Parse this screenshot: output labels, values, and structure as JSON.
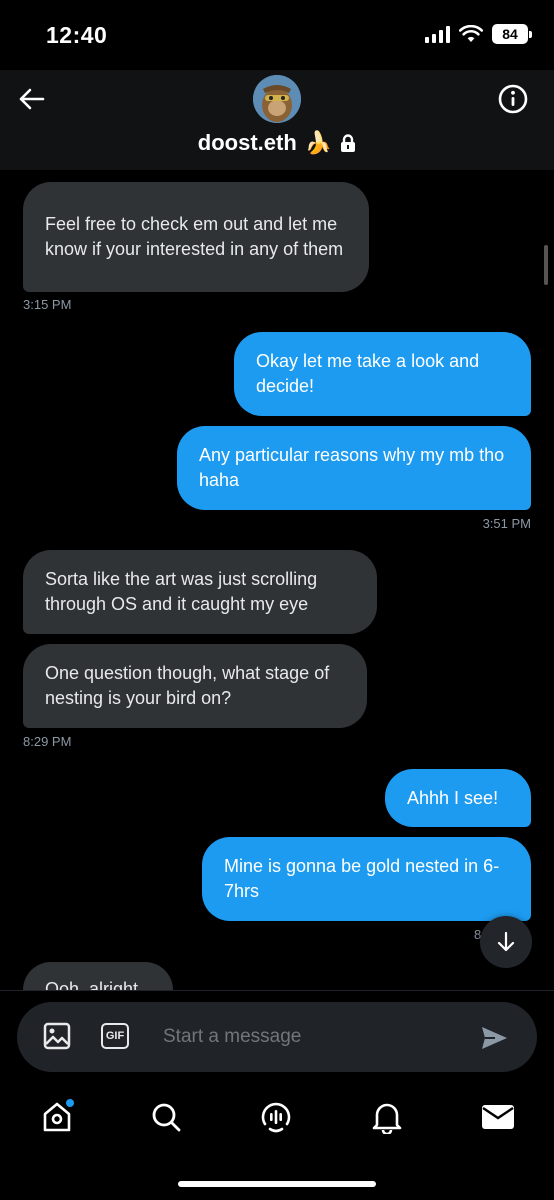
{
  "status_bar": {
    "time": "12:40",
    "battery": "84"
  },
  "header": {
    "name": "doost.eth",
    "name_emoji": "🍌"
  },
  "messages": [
    {
      "text": "Feel free to  check em out and let me know if your interested in any of them",
      "direction": "received"
    },
    {
      "timestamp": "3:15 PM"
    },
    {
      "text": "Okay let me take a look and decide!",
      "direction": "sent"
    },
    {
      "text": "Any particular reasons why my mb tho haha",
      "direction": "sent"
    },
    {
      "timestamp": "3:51 PM"
    },
    {
      "text": "Sorta like the art was just scrolling through OS and it caught my eye",
      "direction": "received"
    },
    {
      "text": "One question though, what stage of nesting is your bird on?",
      "direction": "received"
    },
    {
      "timestamp": "8:29 PM"
    },
    {
      "text": "Ahhh I see!",
      "direction": "sent"
    },
    {
      "text": "Mine is gonna be gold nested in 6-7hrs",
      "direction": "sent"
    },
    {
      "timestamp": "8"
    },
    {
      "text": "Ooh, alright",
      "direction": "received"
    }
  ],
  "composer": {
    "placeholder": "Start a message",
    "gif_label": "GIF"
  },
  "colors": {
    "sent_bubble": "#1d9bf0",
    "received_bubble": "#2f3336",
    "background": "#000000"
  },
  "tab_bar": {
    "items": [
      "home-icon",
      "search-icon",
      "spaces-icon",
      "notifications-icon",
      "messages-icon"
    ],
    "home_has_badge": true
  }
}
